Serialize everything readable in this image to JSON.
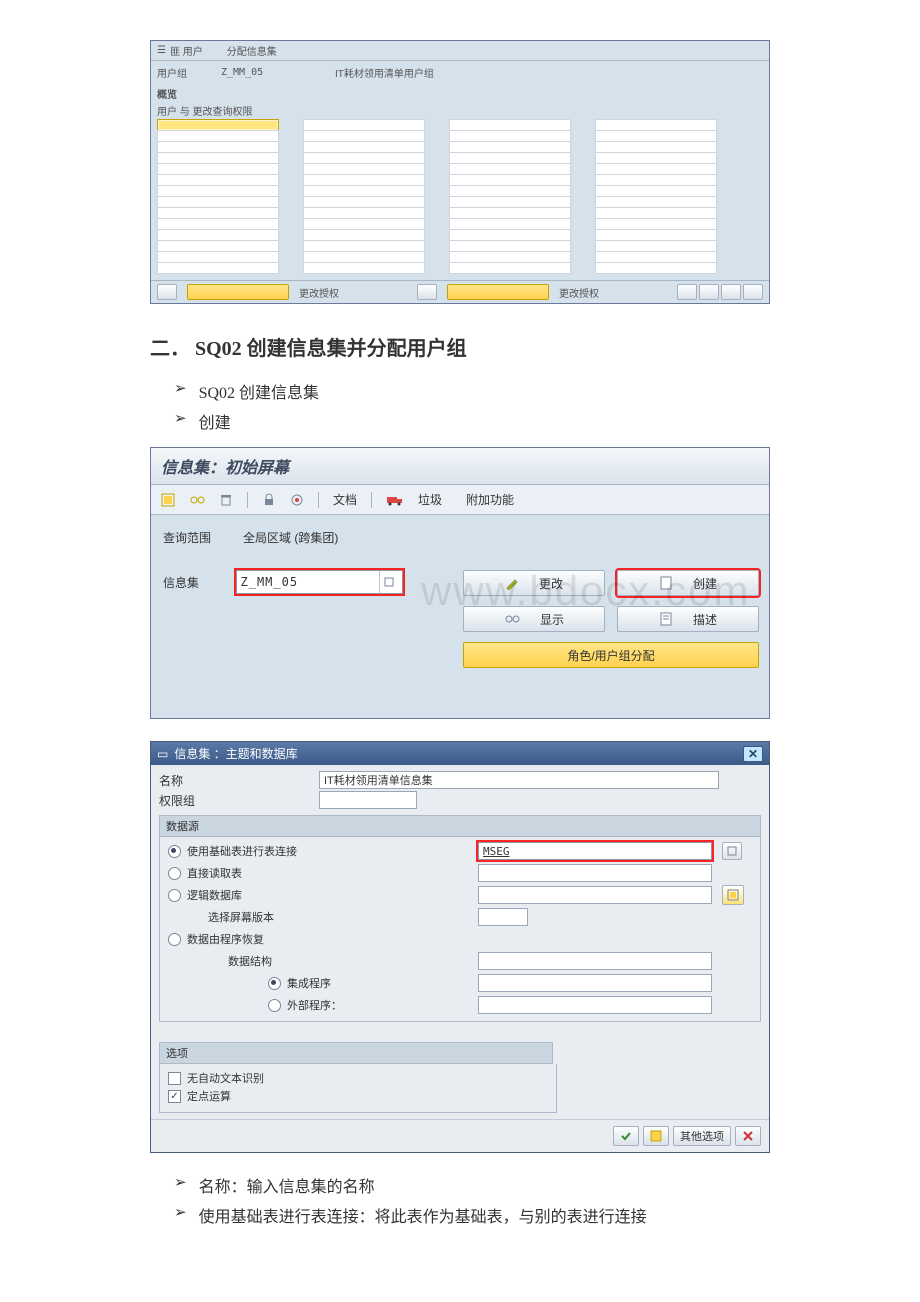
{
  "screenshot1": {
    "toolbar": {
      "assignUsers": "匪 用户",
      "allocInfoset": "分配信息集"
    },
    "userGroupLabel": "用户组",
    "userGroupCode": "Z_MM_05",
    "userGroupDesc": "IT耗材领用清单用户组",
    "overviewTitle": "概览",
    "overviewSub": "用户      与      更改查询权限",
    "footer": {
      "btn1": "更改授权",
      "btn2": "更改授权"
    }
  },
  "heading": "二．  SQ02 创建信息集并分配用户组",
  "bullets1": [
    "SQ02 创建信息集",
    "创建"
  ],
  "screenshot2": {
    "title": "信息集：初始屏幕",
    "tb": {
      "docs": "文档",
      "trash": "垃圾",
      "addon": "附加功能"
    },
    "scopeLabel": "查询范围",
    "scopeValue": "全局区域 (跨集团)",
    "infosetLabel": "信息集",
    "infosetValue": "Z_MM_05",
    "btns": {
      "change": "更改",
      "create": "创建",
      "display": "显示",
      "describe": "描述",
      "roleAssign": "角色/用户组分配"
    },
    "watermark": "www.bdocx.com"
  },
  "dialog": {
    "title": "信息集 ：主题和数据库",
    "nameLabel": "名称",
    "nameValue": "IT耗材领用清单信息集",
    "authLabel": "权限组",
    "dsTitle": "数据源",
    "radios": {
      "tableJoin": "使用基础表进行表连接",
      "directRead": "直接读取表",
      "logicalDb": "逻辑数据库",
      "screenVer": "选择屏幕版本",
      "dataRecover": "数据由程序恢复",
      "dataStruct": "数据结构",
      "integrated": "集成程序",
      "external": "外部程序："
    },
    "mseg": "MSEG",
    "optionsTitle": "选项",
    "noAutoText": "无自动文本识别",
    "fixedPoint": "定点运算",
    "footer": {
      "other": "其他选项"
    }
  },
  "bullets2": [
    "名称：输入信息集的名称",
    "使用基础表进行表连接：将此表作为基础表，与别的表进行连接"
  ]
}
